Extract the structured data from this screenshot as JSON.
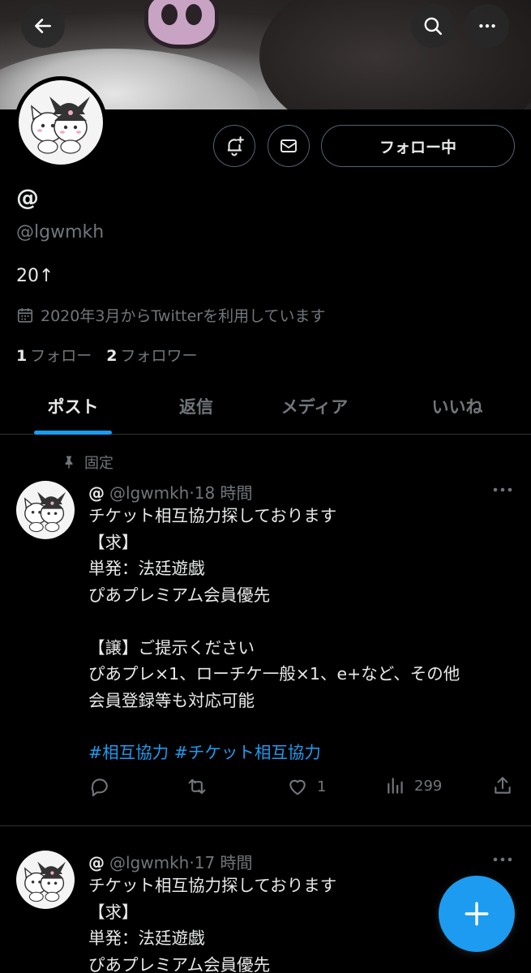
{
  "profile": {
    "display_name": "@",
    "handle": "@lgwmkh",
    "bio": "20↑",
    "joined": "2020年3月からTwitterを利用しています",
    "following_count": "1",
    "following_label": "フォロー",
    "followers_count": "2",
    "followers_label": "フォロワー",
    "follow_button": "フォロー中"
  },
  "tabs": [
    {
      "label": "ポスト",
      "active": true
    },
    {
      "label": "返信",
      "active": false
    },
    {
      "label": "メディア",
      "active": false
    },
    {
      "label": "いいね",
      "active": false
    }
  ],
  "pinned_label": "固定",
  "posts": [
    {
      "name": "@",
      "handle": "@lgwmkh",
      "time": "18 時間",
      "body": "チケット相互協力探しております\n【求】\n単発：法廷遊戯\nぴあプレミアム会員優先\n\n【譲】ご提示ください\nぴあプレ×1、ローチケ一般×1、e+など、その他\n会員登録等も対応可能",
      "hashtags": "#相互協力 #チケット相互協力",
      "replies": "",
      "reposts": "",
      "likes": "1",
      "views": "299"
    },
    {
      "name": "@",
      "handle": "@lgwmkh",
      "time": "17 時間",
      "body": "チケット相互協力探しております\n【求】\n単発：法廷遊戯\nぴあプレミアム会員優先"
    }
  ],
  "colors": {
    "background": "#000000",
    "accent": "#1d9bf0",
    "text": "#e7e9ea",
    "muted": "#71767b",
    "border": "#2f3336"
  },
  "icons": [
    "back-arrow-icon",
    "search-icon",
    "more-icon",
    "notification-bell-icon",
    "mail-icon",
    "calendar-icon",
    "pin-icon",
    "reply-icon",
    "repost-icon",
    "like-icon",
    "views-icon",
    "share-icon",
    "plus-icon"
  ]
}
